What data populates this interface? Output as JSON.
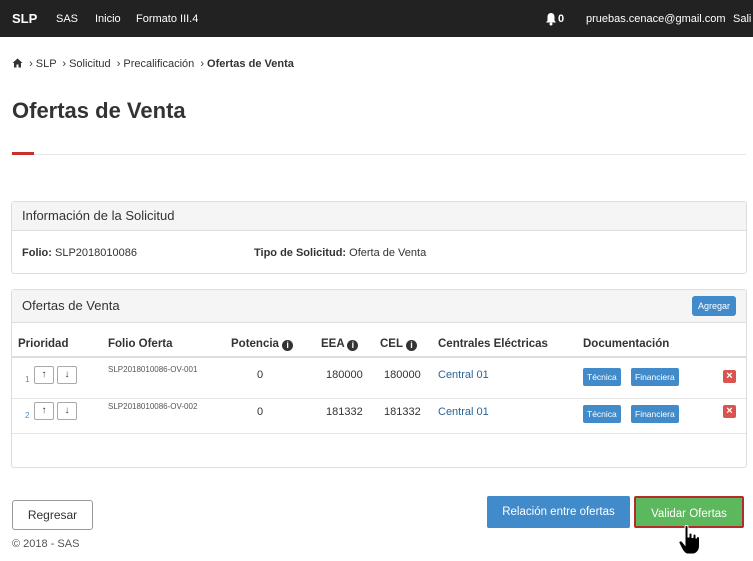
{
  "navbar": {
    "brand": "SLP",
    "items": [
      "SAS",
      "Inicio",
      "Formato III.4"
    ],
    "notifications": "0",
    "email": "pruebas.cenace@gmail.com",
    "logout": "Sali"
  },
  "breadcrumb": [
    "SLP",
    "Solicitud",
    "Precalificación",
    "Ofertas de Venta"
  ],
  "page_title": "Ofertas de Venta",
  "info_panel": {
    "title": "Información de la Solicitud",
    "folio_label": "Folio:",
    "folio_value": "SLP2018010086",
    "tipo_label": "Tipo de Solicitud:",
    "tipo_value": "Oferta de Venta"
  },
  "offers_panel": {
    "title": "Ofertas de Venta",
    "add_button": "Agregar",
    "columns": [
      "Prioridad",
      "Folio Oferta",
      "Potencia",
      "EEA",
      "CEL",
      "Centrales Eléctricas",
      "Documentación"
    ],
    "rows": [
      {
        "priority": "1",
        "folio": "SLP2018010086-OV-001",
        "potencia": "0",
        "eea": "180000",
        "cel": "180000",
        "central": "Central 01",
        "doc1": "Técnica",
        "doc2": "Financiera"
      },
      {
        "priority": "2",
        "folio": "SLP2018010086-OV-002",
        "potencia": "0",
        "eea": "181332",
        "cel": "181332",
        "central": "Central 01",
        "doc1": "Técnica",
        "doc2": "Financiera"
      }
    ]
  },
  "buttons": {
    "back": "Regresar",
    "relation": "Relación entre ofertas",
    "validate": "Validar Ofertas"
  },
  "footer": "© 2018 - SAS",
  "colors": {
    "primary": "#428bca",
    "success": "#5cb85c",
    "danger": "#d9534f",
    "navbar": "#222222"
  }
}
